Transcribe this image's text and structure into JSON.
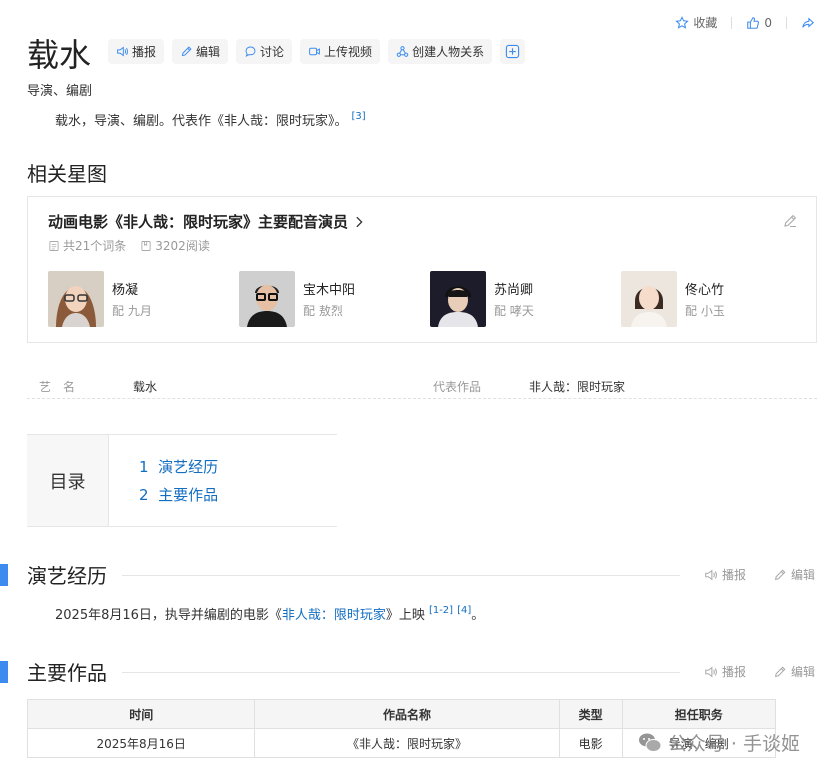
{
  "header": {
    "collect_label": "收藏",
    "like_count": "0"
  },
  "entry": {
    "title": "载水",
    "tools": [
      {
        "label": "播报"
      },
      {
        "label": "编辑"
      },
      {
        "label": "讨论"
      },
      {
        "label": "上传视频"
      },
      {
        "label": "创建人物关系"
      }
    ],
    "subtitle": "导演、编剧",
    "summary": "载水，导演、编剧。代表作《非人哉：限时玩家》。",
    "summary_ref": "[3]"
  },
  "star_map": {
    "section_title": "相关星图",
    "box_title": "动画电影《非人哉：限时玩家》主要配音演员",
    "entry_count": "共21个词条",
    "read_count": "3202阅读",
    "actors": [
      {
        "name": "杨凝",
        "role": "配 九月"
      },
      {
        "name": "宝木中阳",
        "role": "配 敖烈"
      },
      {
        "name": "苏尚卿",
        "role": "配 哮天"
      },
      {
        "name": "佟心竹",
        "role": "配 小玉"
      }
    ]
  },
  "basic_info": {
    "name_label": "艺　名",
    "name_value": "载水",
    "works_label": "代表作品",
    "works_value": "非人哉：限时玩家"
  },
  "catalog": {
    "label": "目录",
    "items": [
      {
        "num": "1",
        "text": "演艺经历"
      },
      {
        "num": "2",
        "text": "主要作品"
      }
    ]
  },
  "sections": {
    "career": {
      "title": "演艺经历",
      "read_label": "播报",
      "edit_label": "编辑",
      "text_before": "2025年8月16日，执导并编剧的电影《",
      "link": "非人哉：限时玩家",
      "text_after": "》上映",
      "ref1": "[1-2]",
      "ref2": "[4]",
      "end": "。"
    },
    "works": {
      "title": "主要作品",
      "read_label": "播报",
      "edit_label": "编辑",
      "columns": [
        "时间",
        "作品名称",
        "类型",
        "担任职务"
      ],
      "rows": [
        [
          "2025年8月16日",
          "《非人哉：限时玩家》",
          "电影",
          "导演、编剧"
        ]
      ]
    }
  },
  "watermark": {
    "text": "公众号 · 手谈姬"
  },
  "colors": {
    "accent": "#3c8cf0",
    "link": "#136ec2"
  }
}
